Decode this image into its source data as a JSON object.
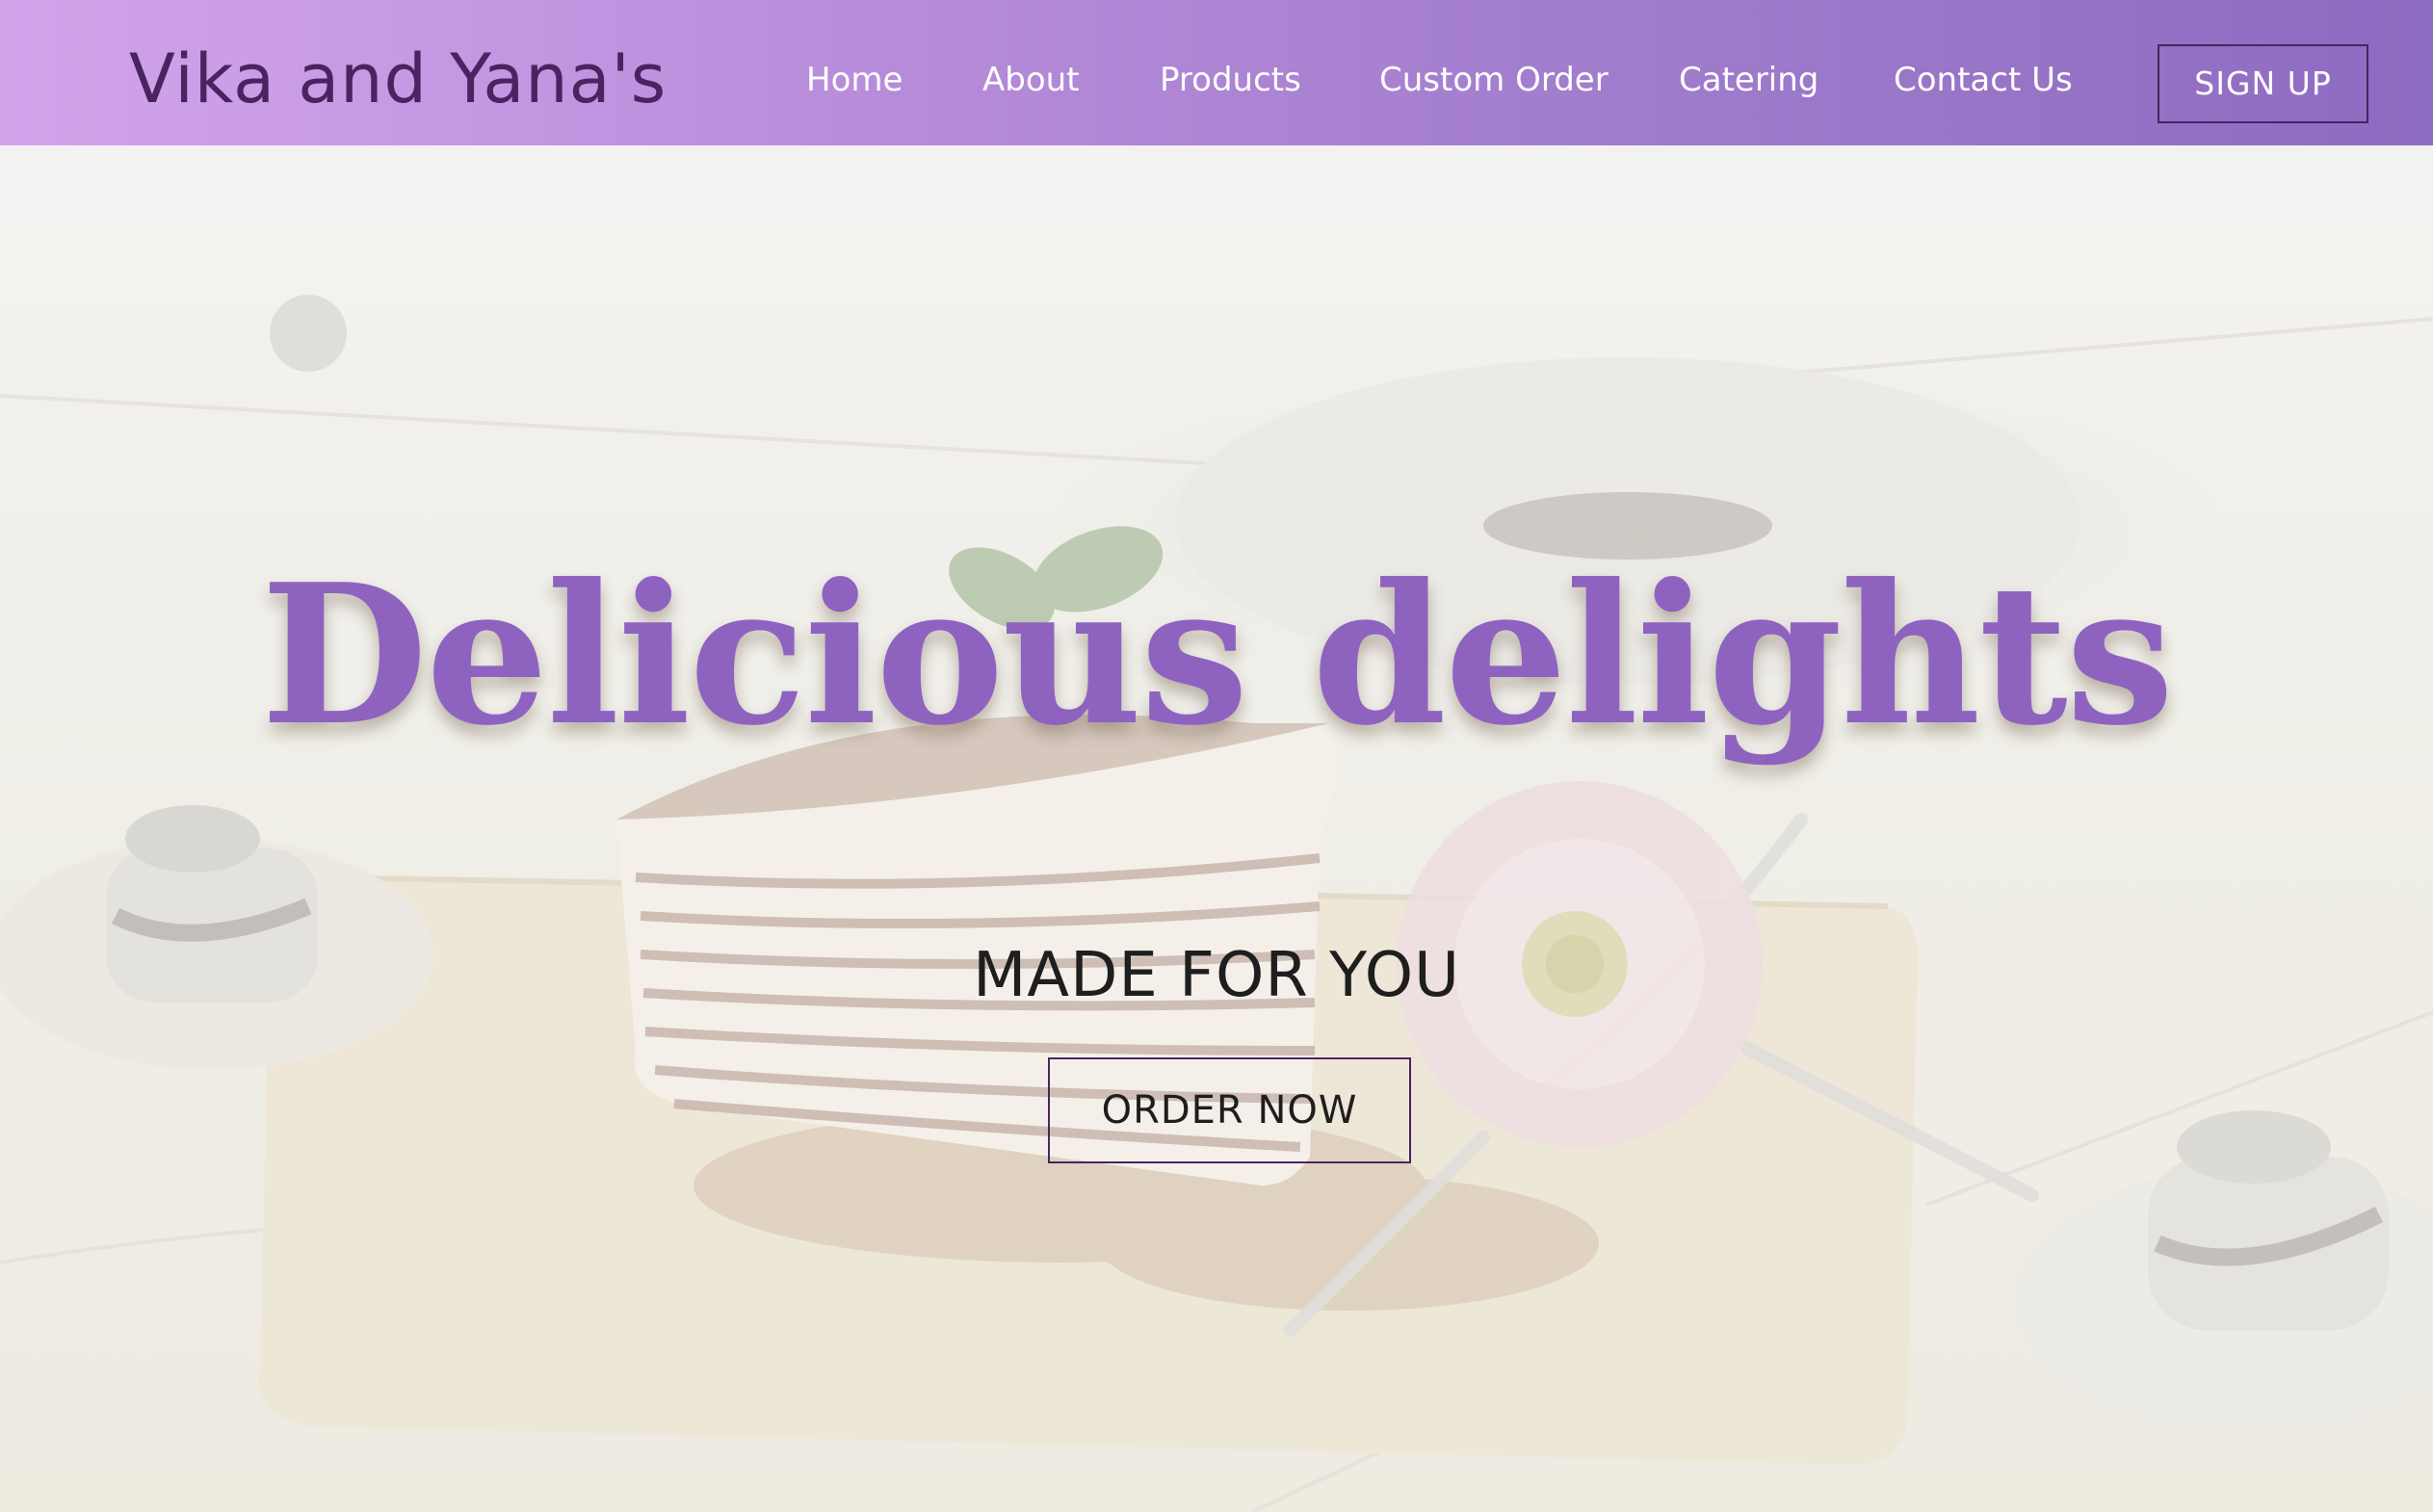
{
  "header": {
    "brand": "Vika and Yana's",
    "nav": [
      {
        "label": "Home"
      },
      {
        "label": "About"
      },
      {
        "label": "Products"
      },
      {
        "label": "Custom Order"
      },
      {
        "label": "Catering"
      },
      {
        "label": "Contact Us"
      }
    ],
    "signup_label": "SIGN UP"
  },
  "hero": {
    "title": "Delicious delights",
    "subtitle": "MADE FOR YOU",
    "cta_label": "ORDER NOW",
    "background_image": "crepe-cake-with-flower-and-fork"
  },
  "colors": {
    "header_gradient_start": "#d3a4ec",
    "header_gradient_end": "#8e6bc2",
    "brand_text": "#4a2460",
    "title_purple": "#8e63c0",
    "button_border": "#4a2460"
  }
}
